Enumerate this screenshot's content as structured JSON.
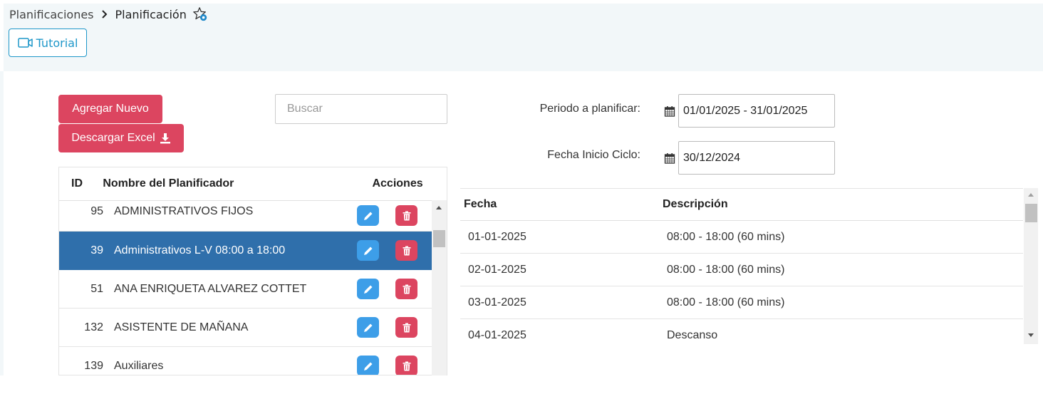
{
  "breadcrumb": {
    "parent": "Planificaciones",
    "current": "Planificación",
    "separator_icon": "chevron-right-icon",
    "favorite_icon": "star-settings-icon"
  },
  "toolbar": {
    "tutorial_label": "Tutorial",
    "tutorial_icon": "video-camera-icon",
    "add_label": "Agregar Nuevo",
    "excel_label": "Descargar Excel",
    "excel_icon": "download-icon"
  },
  "search": {
    "placeholder": "Buscar",
    "value": ""
  },
  "planners_table": {
    "headers": {
      "id": "ID",
      "name": "Nombre del Planificador",
      "actions": "Acciones"
    },
    "rows": [
      {
        "id": "95",
        "name": "ADMINISTRATIVOS FIJOS",
        "selected": false
      },
      {
        "id": "39",
        "name": "Administrativos L-V 08:00 a 18:00",
        "selected": true
      },
      {
        "id": "51",
        "name": "ANA ENRIQUETA ALVAREZ COTTET",
        "selected": false
      },
      {
        "id": "132",
        "name": "ASISTENTE DE MAÑANA",
        "selected": false
      },
      {
        "id": "139",
        "name": "Auxiliares",
        "selected": false
      }
    ]
  },
  "form": {
    "periodo_label": "Periodo a planificar:",
    "periodo_value": "01/01/2025 - 31/01/2025",
    "fecha_inicio_label": "Fecha Inicio Ciclo:",
    "fecha_inicio_value": "30/12/2024",
    "calendar_icon": "calendar-icon"
  },
  "schedule_table": {
    "headers": {
      "fecha": "Fecha",
      "descripcion": "Descripción"
    },
    "rows": [
      {
        "fecha": "01-01-2025",
        "descripcion": "08:00 - 18:00 (60 mins)"
      },
      {
        "fecha": "02-01-2025",
        "descripcion": "08:00 - 18:00 (60 mins)"
      },
      {
        "fecha": "03-01-2025",
        "descripcion": "08:00 - 18:00 (60 mins)"
      },
      {
        "fecha": "04-01-2025",
        "descripcion": "Descanso"
      }
    ]
  },
  "colors": {
    "accent_red": "#dc4560",
    "accent_blue": "#3d9ee8",
    "selected_row": "#2f6fab",
    "tutorial_blue": "#1e97c9",
    "header_bg": "#f2f7f9"
  }
}
